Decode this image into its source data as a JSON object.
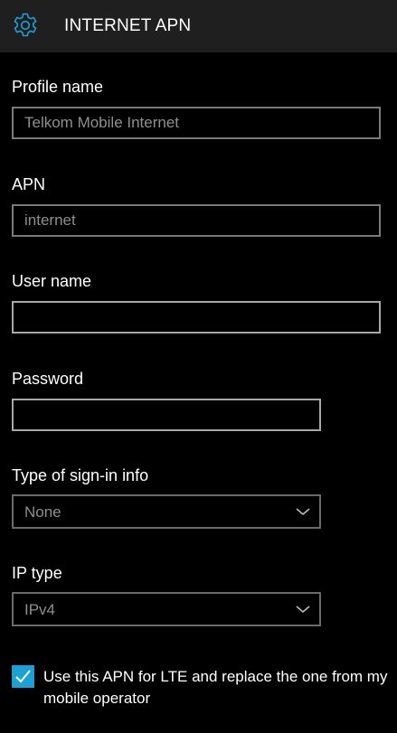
{
  "header": {
    "title": "INTERNET APN",
    "icon": "gear-icon",
    "accent": "#1ba1d6"
  },
  "form": {
    "profile_name": {
      "label": "Profile name",
      "value": "Telkom Mobile Internet"
    },
    "apn": {
      "label": "APN",
      "value": "internet"
    },
    "user_name": {
      "label": "User name",
      "value": ""
    },
    "password": {
      "label": "Password",
      "value": ""
    },
    "sign_in_type": {
      "label": "Type of sign-in info",
      "selected": "None"
    },
    "ip_type": {
      "label": "IP type",
      "selected": "IPv4"
    },
    "lte_option": {
      "label": "Use this APN for LTE and replace the one from my mobile operator",
      "checked": true
    }
  }
}
